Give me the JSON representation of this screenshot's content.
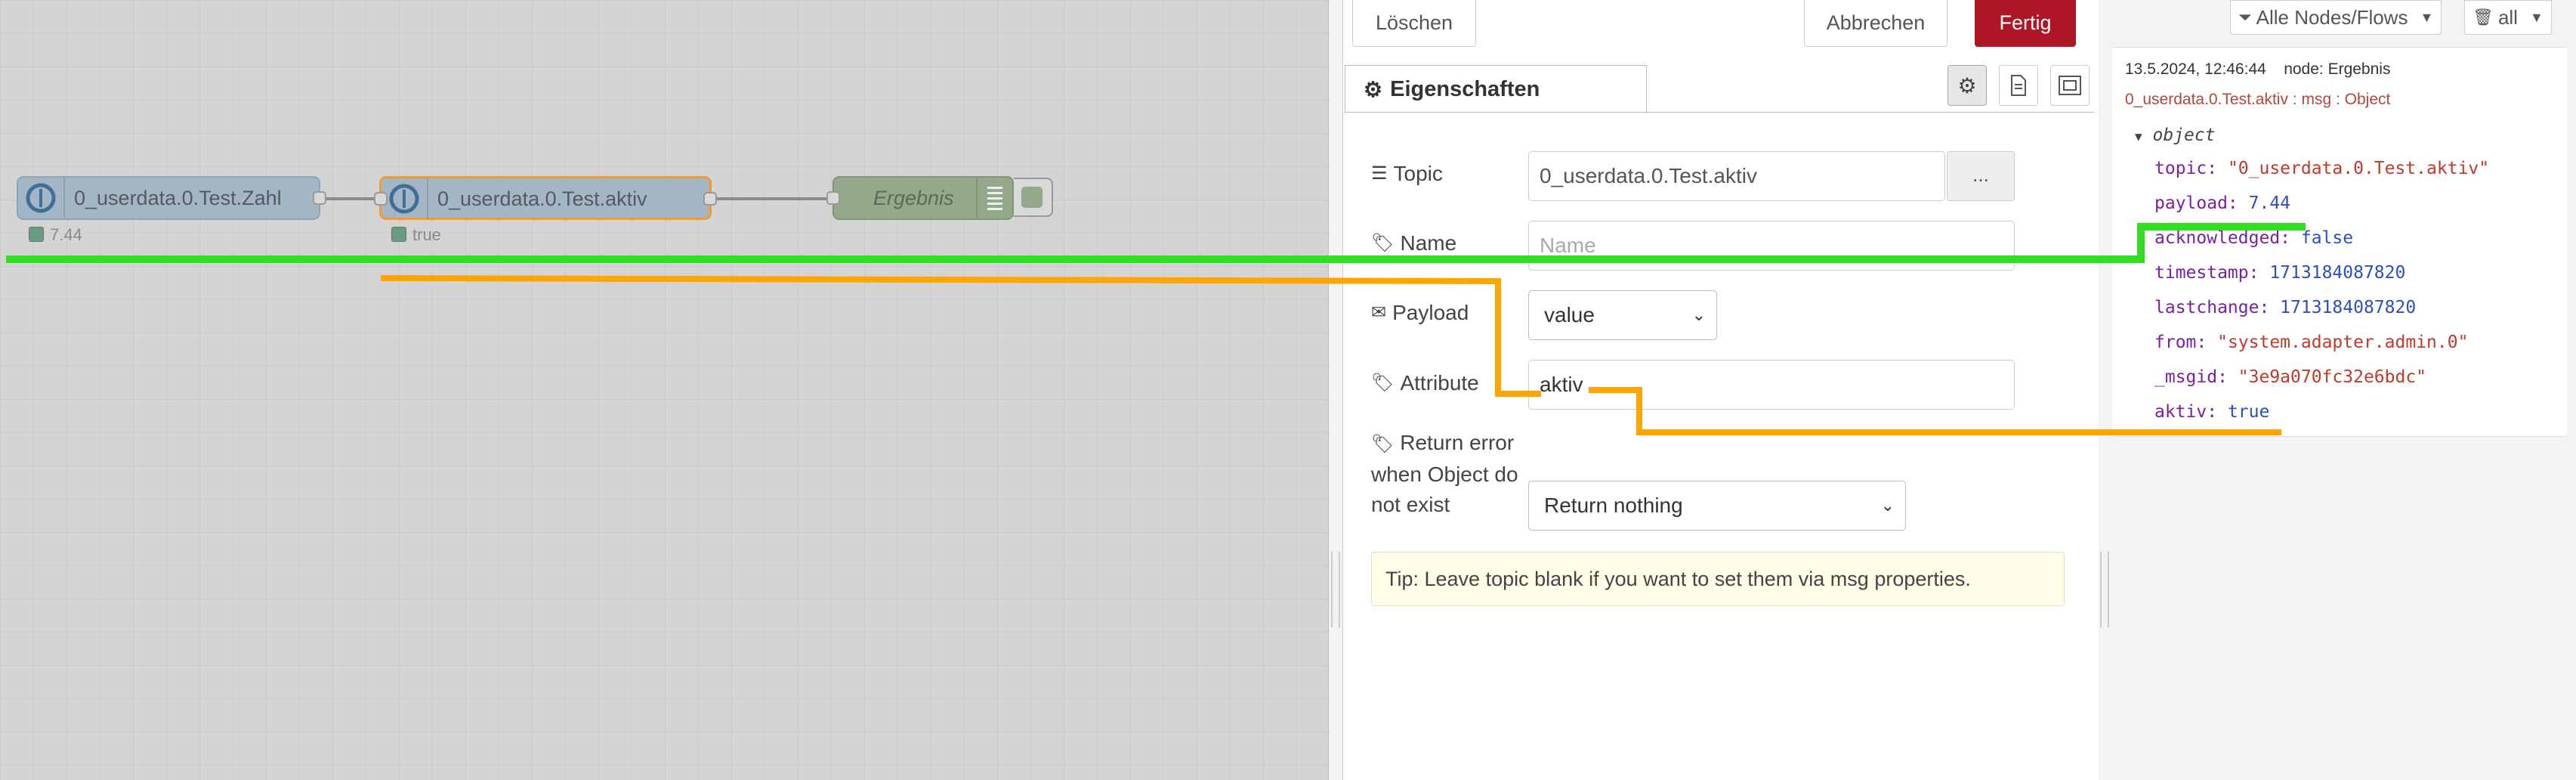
{
  "flow": {
    "nodes": [
      {
        "label": "0_userdata.0.Test.Zahl",
        "status": "7.44"
      },
      {
        "label": "0_userdata.0.Test.aktiv",
        "status": "true"
      },
      {
        "label": "Ergebnis"
      }
    ]
  },
  "editor": {
    "buttons": {
      "delete": "Löschen",
      "cancel": "Abbrechen",
      "done": "Fertig"
    },
    "tab": "Eigenschaften",
    "fields": {
      "topic_label": "Topic",
      "topic_value": "0_userdata.0.Test.aktiv",
      "topic_browse": "...",
      "name_label": "Name",
      "name_placeholder": "Name",
      "payload_label": "Payload",
      "payload_value": "value",
      "attribute_label": "Attribute",
      "attribute_value": "aktiv",
      "return_error_label_1": "Return error",
      "return_error_label_2": "when Object do",
      "return_error_label_3": "not exist",
      "return_error_value": "Return nothing"
    },
    "tip": "Tip: Leave topic blank if you want to set them via msg properties."
  },
  "sidebar": {
    "filter_label": "Alle Nodes/Flows",
    "clear_label": "all",
    "message": {
      "timestamp": "13.5.2024, 12:46:44",
      "node": "node: Ergebnis",
      "path": "0_userdata.0.Test.aktiv : msg : Object",
      "root": "object",
      "props": [
        {
          "key": "topic",
          "value": "\"0_userdata.0.Test.aktiv\"",
          "type": "string"
        },
        {
          "key": "payload",
          "value": "7.44",
          "type": "number"
        },
        {
          "key": "acknowledged",
          "value": "false",
          "type": "number"
        },
        {
          "key": "timestamp",
          "value": "1713184087820",
          "type": "number"
        },
        {
          "key": "lastchange",
          "value": "1713184087820",
          "type": "number"
        },
        {
          "key": "from",
          "value": "\"system.adapter.admin.0\"",
          "type": "string"
        },
        {
          "key": "_msgid",
          "value": "\"3e9a070fc32e6bdc\"",
          "type": "string"
        },
        {
          "key": "aktiv",
          "value": "true",
          "type": "number"
        }
      ]
    }
  },
  "colors": {
    "accent": "#ad1625",
    "annotation_green": "#33dd22",
    "annotation_orange": "#ffa500"
  }
}
